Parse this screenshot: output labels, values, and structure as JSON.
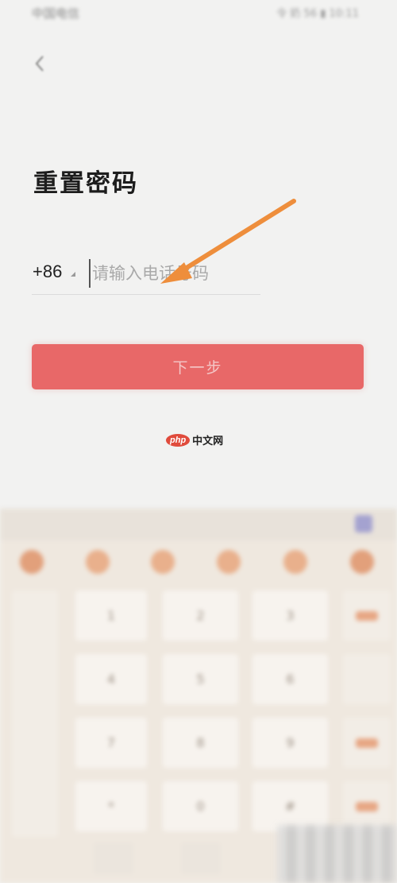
{
  "status": {
    "carrier": "中国电信",
    "right": "令 奶 56 ▮ 10:11"
  },
  "page": {
    "title": "重置密码"
  },
  "phone": {
    "country_code": "+86",
    "placeholder": "请输入电话号码",
    "value": ""
  },
  "actions": {
    "next_label": "下一步"
  },
  "watermark": {
    "badge": "php",
    "text": "中文网"
  },
  "colors": {
    "primary": "#e86868",
    "arrow": "#ee8e3c",
    "background": "#f2f2f1"
  },
  "icons": {
    "back": "chevron-left-icon",
    "arrow": "annotation-arrow-icon"
  },
  "keyboard": {
    "keys": [
      [
        "1",
        "2",
        "3"
      ],
      [
        "4",
        "5",
        "6"
      ],
      [
        "7",
        "8",
        "9"
      ],
      [
        "*",
        "0",
        "#"
      ]
    ]
  }
}
